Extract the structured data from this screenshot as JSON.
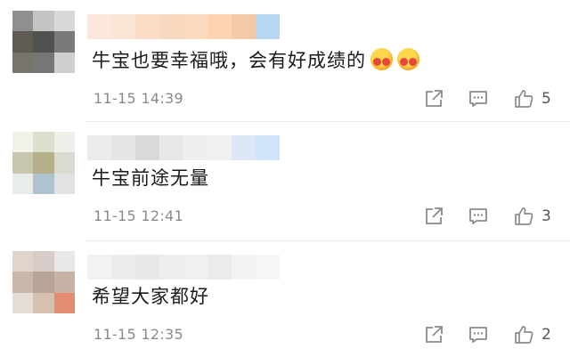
{
  "comments": [
    {
      "text": "牛宝也要幸福哦，会有好成绩的",
      "emoji_icons": [
        "hugging-face-icon",
        "hugging-face-icon"
      ],
      "time": "11-15 14:39",
      "likes": "5",
      "avatar_colors": [
        "#8f8f8f",
        "#c4c4c4",
        "#d8d8d8",
        "#5f5a52",
        "#4f514e",
        "#7a7b78",
        "#77736d",
        "#777876",
        "#cfcfcf"
      ],
      "name_colors": [
        "#fde6dc",
        "#fbe4d6",
        "#fbdcc6",
        "#f9d8c0",
        "#fcd9bd",
        "#fcd3b0",
        "#f4c9a7",
        "#b7d6f2"
      ]
    },
    {
      "text": "牛宝前途无量",
      "time": "11-15 12:41",
      "likes": "3",
      "avatar_colors": [
        "#f1f1ea",
        "#dde0cc",
        "#f0f0ea",
        "#c7c7b0",
        "#b5b08a",
        "#dadad2",
        "#e9ede9",
        "#aec2cf",
        "#e2e2e2"
      ],
      "name_colors": [
        "#ececec",
        "#e6e6e6",
        "#d9d9d9",
        "#e7e7e7",
        "#eeeeee",
        "#f1f1f1",
        "#dce8f7",
        "#cfe3fa"
      ]
    },
    {
      "text": "希望大家都好",
      "time": "11-15 12:35",
      "likes": "2",
      "avatar_colors": [
        "#e0d4cd",
        "#d8ccc8",
        "#e7e7e7",
        "#c9b7aa",
        "#b7a398",
        "#c8b2a6",
        "#e6ddd7",
        "#d6c0b0",
        "#e38c72"
      ],
      "name_colors": [
        "#f2f2f2",
        "#ececec",
        "#e8e8e8",
        "#eeeeee",
        "#f0f0f0",
        "#ebebeb",
        "#f3f3f3",
        "#f6f6f6"
      ]
    }
  ],
  "actions": {
    "share_icon": "share-icon",
    "reply_icon": "comment-icon",
    "like_icon": "thumbs-up-icon"
  }
}
